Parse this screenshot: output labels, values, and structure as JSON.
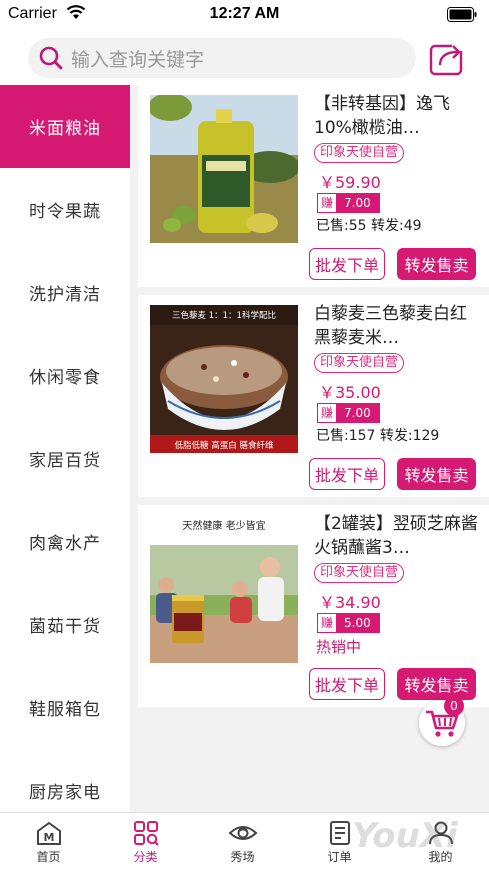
{
  "status_bar": {
    "carrier": "Carrier",
    "time": "12:27 AM"
  },
  "search": {
    "placeholder": "输入查询关键字"
  },
  "sidebar": {
    "items": [
      {
        "label": "米面粮油",
        "active": true
      },
      {
        "label": "时令果蔬"
      },
      {
        "label": "洗护清洁"
      },
      {
        "label": "休闲零食"
      },
      {
        "label": "家居百货"
      },
      {
        "label": "肉禽水产"
      },
      {
        "label": "菌茹干货"
      },
      {
        "label": "鞋服箱包"
      },
      {
        "label": "厨房家电"
      }
    ]
  },
  "products": [
    {
      "title": "【非转基因】逸飞10%橄榄油…",
      "shop": "印象天使自营",
      "price": "￥59.90",
      "earn_label": "赚",
      "earn_value": "7.00",
      "sales": "已售:55  转发:49",
      "wholesale_label": "批发下单",
      "forward_label": "转发售卖"
    },
    {
      "title": "白藜麦三色藜麦白红黑藜麦米…",
      "shop": "印象天使自营",
      "price": "￥35.00",
      "earn_label": "赚",
      "earn_value": "7.00",
      "sales": "已售:157  转发:129",
      "image_text_top": "三色藜麦 1：1：1科学配比",
      "image_text_bottom": "低脂低糖  高蛋白  膳食纤维",
      "wholesale_label": "批发下单",
      "forward_label": "转发售卖"
    },
    {
      "title": "【2罐装】翌硕芝麻酱火锅蘸酱3…",
      "shop": "印象天使自营",
      "price": "￥34.90",
      "earn_label": "赚",
      "earn_value": "5.00",
      "hot_label": "热销中",
      "image_text_top": "天然健康  老少皆宜",
      "wholesale_label": "批发下单",
      "forward_label": "转发售卖"
    }
  ],
  "cart": {
    "count": "0"
  },
  "tabbar": {
    "items": [
      {
        "label": "首页",
        "icon": "home-icon"
      },
      {
        "label": "分类",
        "icon": "category-icon",
        "active": true
      },
      {
        "label": "秀场",
        "icon": "eye-icon"
      },
      {
        "label": "订单",
        "icon": "order-icon"
      },
      {
        "label": "我的",
        "icon": "profile-icon"
      }
    ]
  },
  "watermark": "YouXi",
  "colors": {
    "accent": "#d61a73",
    "background": "#f2f2f2"
  }
}
